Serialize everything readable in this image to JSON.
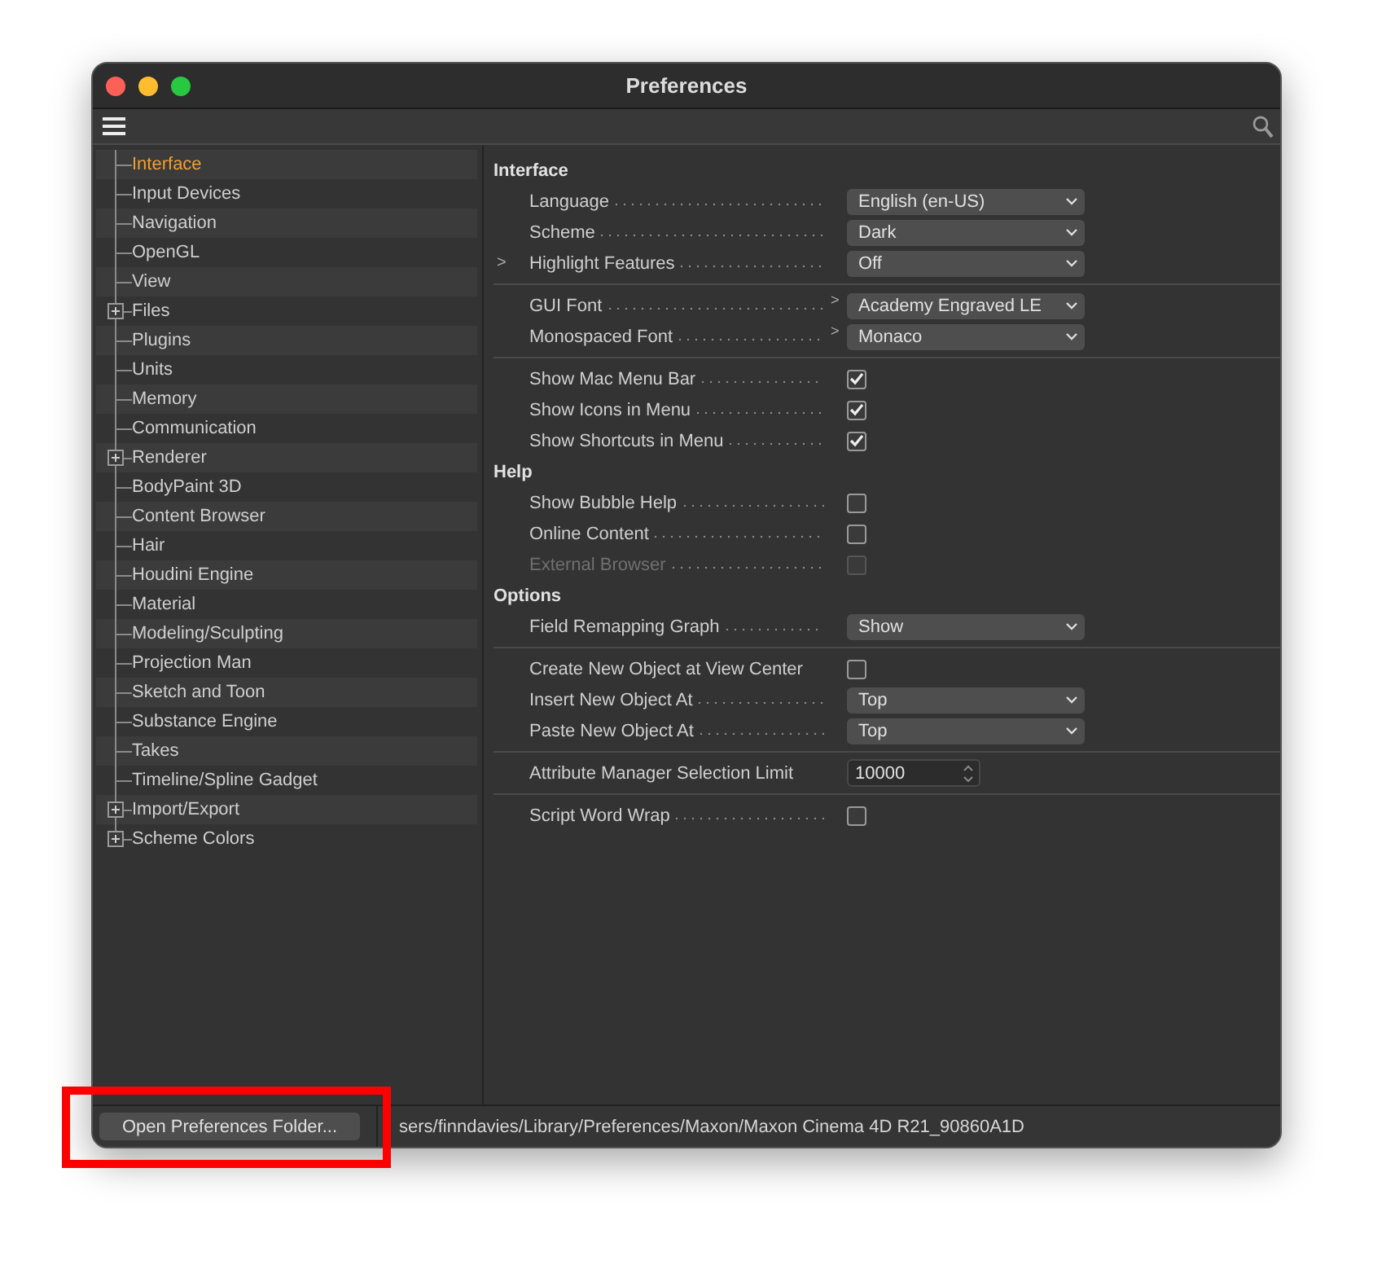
{
  "window": {
    "title": "Preferences"
  },
  "sidebar": {
    "items": [
      {
        "label": "Interface",
        "selected": true,
        "has_children": false
      },
      {
        "label": "Input Devices",
        "selected": false,
        "has_children": false
      },
      {
        "label": "Navigation",
        "selected": false,
        "has_children": false
      },
      {
        "label": "OpenGL",
        "selected": false,
        "has_children": false
      },
      {
        "label": "View",
        "selected": false,
        "has_children": false
      },
      {
        "label": "Files",
        "selected": false,
        "has_children": true
      },
      {
        "label": "Plugins",
        "selected": false,
        "has_children": false
      },
      {
        "label": "Units",
        "selected": false,
        "has_children": false
      },
      {
        "label": "Memory",
        "selected": false,
        "has_children": false
      },
      {
        "label": "Communication",
        "selected": false,
        "has_children": false
      },
      {
        "label": "Renderer",
        "selected": false,
        "has_children": true
      },
      {
        "label": "BodyPaint 3D",
        "selected": false,
        "has_children": false
      },
      {
        "label": "Content Browser",
        "selected": false,
        "has_children": false
      },
      {
        "label": "Hair",
        "selected": false,
        "has_children": false
      },
      {
        "label": "Houdini Engine",
        "selected": false,
        "has_children": false
      },
      {
        "label": "Material",
        "selected": false,
        "has_children": false
      },
      {
        "label": "Modeling/Sculpting",
        "selected": false,
        "has_children": false
      },
      {
        "label": "Projection Man",
        "selected": false,
        "has_children": false
      },
      {
        "label": "Sketch and Toon",
        "selected": false,
        "has_children": false
      },
      {
        "label": "Substance Engine",
        "selected": false,
        "has_children": false
      },
      {
        "label": "Takes",
        "selected": false,
        "has_children": false
      },
      {
        "label": "Timeline/Spline Gadget",
        "selected": false,
        "has_children": false
      },
      {
        "label": "Import/Export",
        "selected": false,
        "has_children": true
      },
      {
        "label": "Scheme Colors",
        "selected": false,
        "has_children": true
      }
    ]
  },
  "sections": [
    {
      "title": "Interface",
      "rows": [
        {
          "kind": "dropdown",
          "label": "Language",
          "value": "English (en-US)",
          "dots": true
        },
        {
          "kind": "dropdown",
          "label": "Scheme",
          "value": "Dark",
          "dots": true
        },
        {
          "kind": "dropdown",
          "label": "Highlight Features",
          "value": "Off",
          "dots": true,
          "expander": ">"
        },
        {
          "kind": "divider"
        },
        {
          "kind": "dropdown",
          "label": "GUI Font",
          "value": "Academy Engraved LE",
          "dots": true,
          "submenu": ">"
        },
        {
          "kind": "dropdown",
          "label": "Monospaced Font",
          "value": "Monaco",
          "dots": true,
          "submenu": ">"
        },
        {
          "kind": "divider"
        },
        {
          "kind": "checkbox",
          "label": "Show Mac Menu Bar",
          "checked": true,
          "disabled": false,
          "dots": true
        },
        {
          "kind": "checkbox",
          "label": "Show Icons in Menu",
          "checked": true,
          "disabled": false,
          "dots": true
        },
        {
          "kind": "checkbox",
          "label": "Show Shortcuts in Menu",
          "checked": true,
          "disabled": false,
          "dots": true
        }
      ]
    },
    {
      "title": "Help",
      "rows": [
        {
          "kind": "checkbox",
          "label": "Show Bubble Help",
          "checked": false,
          "disabled": false,
          "dots": true
        },
        {
          "kind": "checkbox",
          "label": "Online Content",
          "checked": false,
          "disabled": false,
          "dots": true
        },
        {
          "kind": "checkbox",
          "label": "External Browser",
          "checked": false,
          "disabled": true,
          "dots": true
        }
      ]
    },
    {
      "title": "Options",
      "rows": [
        {
          "kind": "dropdown",
          "label": "Field Remapping Graph",
          "value": "Show",
          "dots": true
        },
        {
          "kind": "divider"
        },
        {
          "kind": "checkbox",
          "label": "Create New Object at View Center",
          "checked": false,
          "disabled": false,
          "dots": false
        },
        {
          "kind": "dropdown",
          "label": "Insert New Object At",
          "value": "Top",
          "dots": true
        },
        {
          "kind": "dropdown",
          "label": "Paste New Object At",
          "value": "Top",
          "dots": true
        },
        {
          "kind": "divider"
        },
        {
          "kind": "number",
          "label": "Attribute Manager Selection Limit",
          "value": "10000",
          "dots": false
        },
        {
          "kind": "divider"
        },
        {
          "kind": "checkbox",
          "label": "Script Word Wrap",
          "checked": false,
          "disabled": false,
          "dots": true
        }
      ]
    }
  ],
  "footer": {
    "button": {
      "label": "Open Preferences Folder...",
      "highlighted": true
    },
    "path": "sers/finndavies/Library/Preferences/Maxon/Maxon Cinema 4D R21_90860A1D"
  }
}
